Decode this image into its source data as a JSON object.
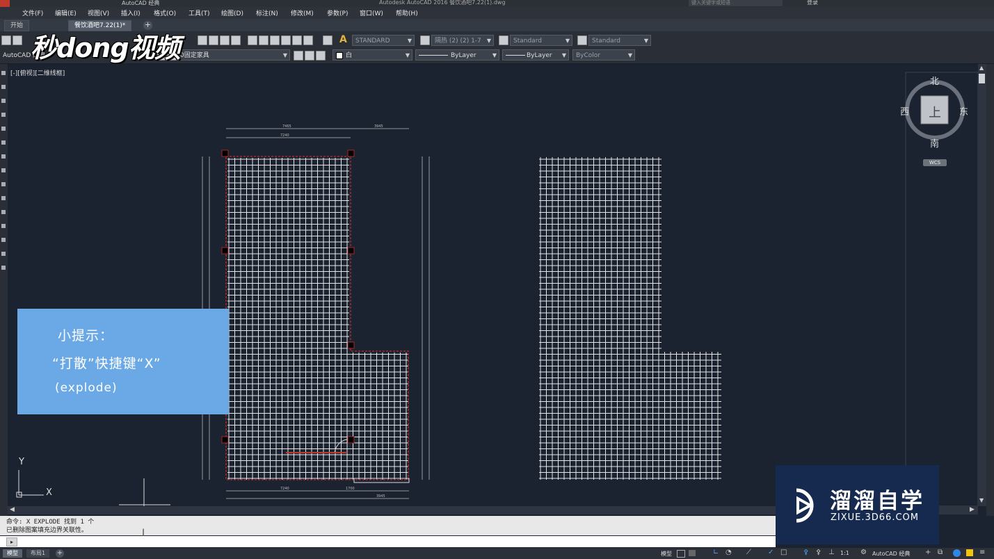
{
  "window": {
    "title": "Autodesk AutoCAD 2016    餐饮酒吧7.22(1).dwg",
    "workspace": "AutoCAD 经典",
    "search_placeholder": "键入关键字或短语",
    "login_label": "登录"
  },
  "menu": [
    "文件(F)",
    "编辑(E)",
    "视图(V)",
    "插入(I)",
    "格式(O)",
    "工具(T)",
    "绘图(D)",
    "标注(N)",
    "修改(M)",
    "参数(P)",
    "窗口(W)",
    "帮助(H)"
  ],
  "tabs": [
    {
      "label": "开始",
      "active": false
    },
    {
      "label": "餐饮酒吧7.22(1)*",
      "active": true
    }
  ],
  "toolbar": {
    "text_style": "STANDARD",
    "dim_style": "隔热 (2) (2) 1-7",
    "table_style": "Standard",
    "multileader_style": "Standard",
    "workspace_label": "AutoCAD 经典",
    "layer": "0固定家具",
    "color": "白",
    "linetype": "ByLayer",
    "lineweight": "ByLayer",
    "plotstyle": "ByColor"
  },
  "logo": {
    "text": "秒dong视频"
  },
  "canvas": {
    "view_label": "[-][俯视][二维线框]",
    "ucs_x": "X",
    "ucs_y": "Y"
  },
  "viewcube": {
    "north": "北",
    "south": "南",
    "east": "东",
    "west": "西",
    "top": "上",
    "wcs": "WCS"
  },
  "dimensions": {
    "top_total": "7465",
    "top_left": "7240",
    "top_right": "3945",
    "bottom_left": "7240",
    "bottom_mid": "1700",
    "bottom_right": "3945"
  },
  "hint": {
    "line1": "小提示：",
    "line2": "“打散”快捷键“X”",
    "line3": "(explode)"
  },
  "command": {
    "history": [
      "命令: X EXPLODE 找到 1 个",
      "已删除图案填充边界关联性。"
    ],
    "prompt": ""
  },
  "layout_tabs": [
    "模型",
    "布局1"
  ],
  "status": {
    "model": "模型",
    "scale": "1:1",
    "workspace": "AutoCAD 经典"
  },
  "watermark": {
    "name": "溜溜自学",
    "url": "ZIXUE.3D66.COM"
  }
}
